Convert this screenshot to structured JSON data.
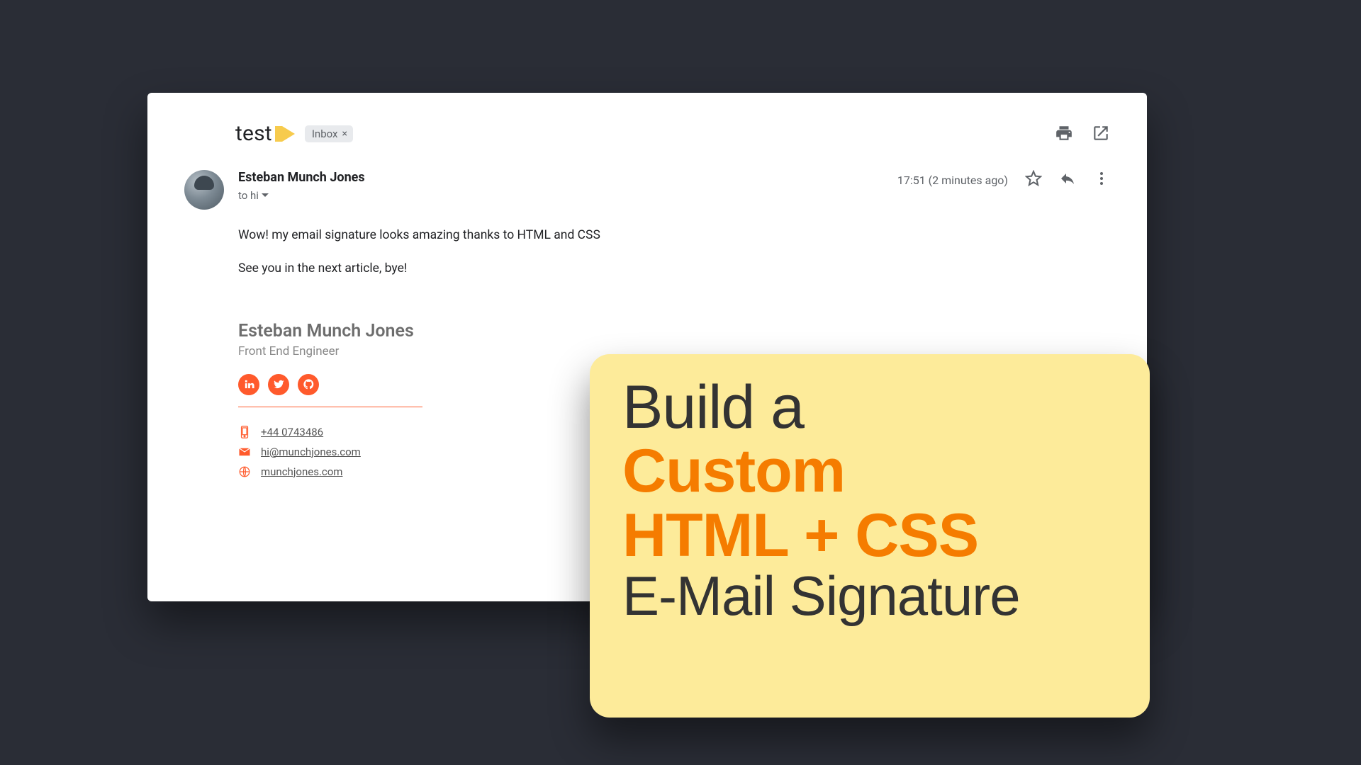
{
  "email": {
    "subject": "test",
    "label": "Inbox",
    "sender_name": "Esteban Munch Jones",
    "recipients_line": "to hi",
    "timestamp": "17:51 (2 minutes ago)",
    "body_line1": "Wow! my email signature looks amazing thanks to HTML and CSS",
    "body_line2": "See you in the next article, bye!"
  },
  "signature": {
    "name": "Esteban Munch Jones",
    "role": "Front End Engineer",
    "phone": "+44 0743486",
    "email": "hi@munchjones.com",
    "website": "munchjones.com"
  },
  "promo": {
    "line1": "Build a",
    "line2": "Custom",
    "line3": "HTML + CSS",
    "line4": "E-Mail Signature"
  },
  "colors": {
    "accent_orange": "#ff5a2c",
    "promo_bg": "#fdeb9a",
    "promo_orange": "#f57c00"
  }
}
